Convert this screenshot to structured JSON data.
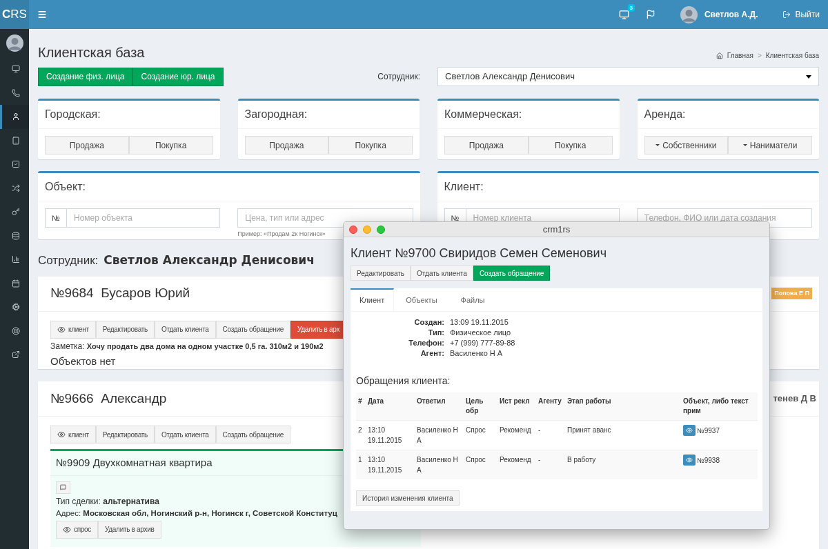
{
  "brand": "**C**RS",
  "topbar": {
    "notifications": "3",
    "user": "Светлов А.Д.",
    "logout": "Выйти"
  },
  "sidebar": {
    "items": [
      {
        "kind": "monitor",
        "selected": false
      },
      {
        "kind": "phone",
        "selected": false
      },
      {
        "kind": "user",
        "selected": true
      },
      {
        "kind": "tablet",
        "selected": false
      },
      {
        "kind": "check",
        "selected": false
      },
      {
        "kind": "shuffle",
        "selected": false
      },
      {
        "kind": "key",
        "selected": false
      },
      {
        "kind": "database",
        "selected": false
      },
      {
        "kind": "chart",
        "selected": false
      },
      {
        "kind": "calendar",
        "selected": false
      },
      {
        "kind": "cogs",
        "selected": false
      },
      {
        "kind": "lifebuoy",
        "selected": false
      },
      {
        "kind": "external",
        "selected": false
      }
    ]
  },
  "page": {
    "title": "Клиентская база",
    "breadcrumb": [
      "Главная",
      "Клиентская база"
    ],
    "breadcrumb_separator": ">"
  },
  "create_buttons": [
    "Создание физ. лица",
    "Создание юр. лица"
  ],
  "employee_filter": {
    "label": "Сотрудник:",
    "value": "Светлов Александр Денисович"
  },
  "categories": [
    {
      "title": "Городская:",
      "buttons": [
        {
          "label": "Продажа",
          "caret": false
        },
        {
          "label": "Покупка",
          "caret": false
        }
      ]
    },
    {
      "title": "Загородная:",
      "buttons": [
        {
          "label": "Продажа",
          "caret": false
        },
        {
          "label": "Покупка",
          "caret": false
        }
      ]
    },
    {
      "title": "Коммерческая:",
      "buttons": [
        {
          "label": "Продажа",
          "caret": false
        },
        {
          "label": "Покупка",
          "caret": false
        }
      ]
    },
    {
      "title": "Аренда:",
      "buttons": [
        {
          "label": "Собственники",
          "caret": true
        },
        {
          "label": "Наниматели",
          "caret": true
        }
      ]
    }
  ],
  "object_search": {
    "title": "Объект:",
    "prefix": "№",
    "number_placeholder": "Номер объекта",
    "query_placeholder": "Цена, тип или адрес",
    "hint": "Пример: «Продам 2к Ногинск»"
  },
  "client_search": {
    "title": "Клиент:",
    "prefix": "№",
    "number_placeholder": "Номер клиента",
    "query_placeholder": "Телефон, ФИО или дата создания"
  },
  "employee_heading": {
    "label": "Сотрудник:",
    "name": "Светлов Александр Денисович"
  },
  "clients": [
    {
      "number": "№9684",
      "name": "Бусаров Юрий",
      "badge": {
        "text": "Попова Е П",
        "color": "#f0ad4e"
      },
      "actions": [
        {
          "label": "клиент",
          "kind": "view"
        },
        {
          "label": "Редактировать",
          "kind": "default"
        },
        {
          "label": "Отдать клиента",
          "kind": "default"
        },
        {
          "label": "Создать обращение",
          "kind": "default"
        },
        {
          "label": "Удалить в арх",
          "kind": "danger"
        }
      ],
      "note": {
        "label": "Заметка:",
        "text": "Хочу продать два дома на одном участке 0,5 га. 310м2 и 190м2"
      },
      "no_objects": "Объектов нет"
    },
    {
      "number": "№9666",
      "name": "Александр",
      "agent": "тенев Д В",
      "actions": [
        {
          "label": "клиент",
          "kind": "view"
        },
        {
          "label": "Редактировать",
          "kind": "default"
        },
        {
          "label": "Отдать клиента",
          "kind": "default"
        },
        {
          "label": "Создать обращение",
          "kind": "default"
        }
      ],
      "objects": [
        {
          "number": "№9909",
          "title": "Двухкомнатная квартира",
          "deal_label": "Тип сделки:",
          "deal": "альтернатива",
          "address_label": "Адрес:",
          "address": "Московская обл, Ногинский р-н, Ногинск г, Советской Конституц",
          "actions": [
            {
              "label": "спрос",
              "kind": "view"
            },
            {
              "label": "Удалить в архив",
              "kind": "default"
            }
          ]
        }
      ]
    }
  ],
  "dialog": {
    "title": "crm1rs",
    "heading": "Клиент №9700 Свиридов Семен Семенович",
    "actions": [
      {
        "label": "Редактировать",
        "kind": "default"
      },
      {
        "label": "Отдать клиента",
        "kind": "default"
      },
      {
        "label": "Создать обращение",
        "kind": "success"
      }
    ],
    "tabs": [
      {
        "label": "Клиент",
        "selected": true
      },
      {
        "label": "Объекты",
        "selected": false
      },
      {
        "label": "Файлы",
        "selected": false
      }
    ],
    "details": [
      {
        "label": "Создан:",
        "value": "13:09 19.11.2015"
      },
      {
        "label": "Тип:",
        "value": "Физическое лицо"
      },
      {
        "label": "Телефон:",
        "value": "+7 (999) 777-89-88"
      },
      {
        "label": "Агент:",
        "value": "Василенко Н А"
      }
    ],
    "requests_title": "Обращения клиента:",
    "table": {
      "columns": [
        "#",
        "Дата",
        "Ответил",
        "Цель обр",
        "Ист рекл",
        "Агенту",
        "Этап работы",
        "Объект, либо текст прим"
      ],
      "rows": [
        {
          "cells": [
            "2",
            "13:10 19.11.2015",
            "Василенко Н А",
            "Спрос",
            "Рекоменд",
            "-",
            "Принят аванс"
          ],
          "object": "№9937"
        },
        {
          "cells": [
            "1",
            "13:10 19.11.2015",
            "Василенко Н А",
            "Спрос",
            "Рекоменд",
            "-",
            "В работу"
          ],
          "object": "№9938"
        }
      ]
    },
    "history_button": "История изменения клиента"
  }
}
